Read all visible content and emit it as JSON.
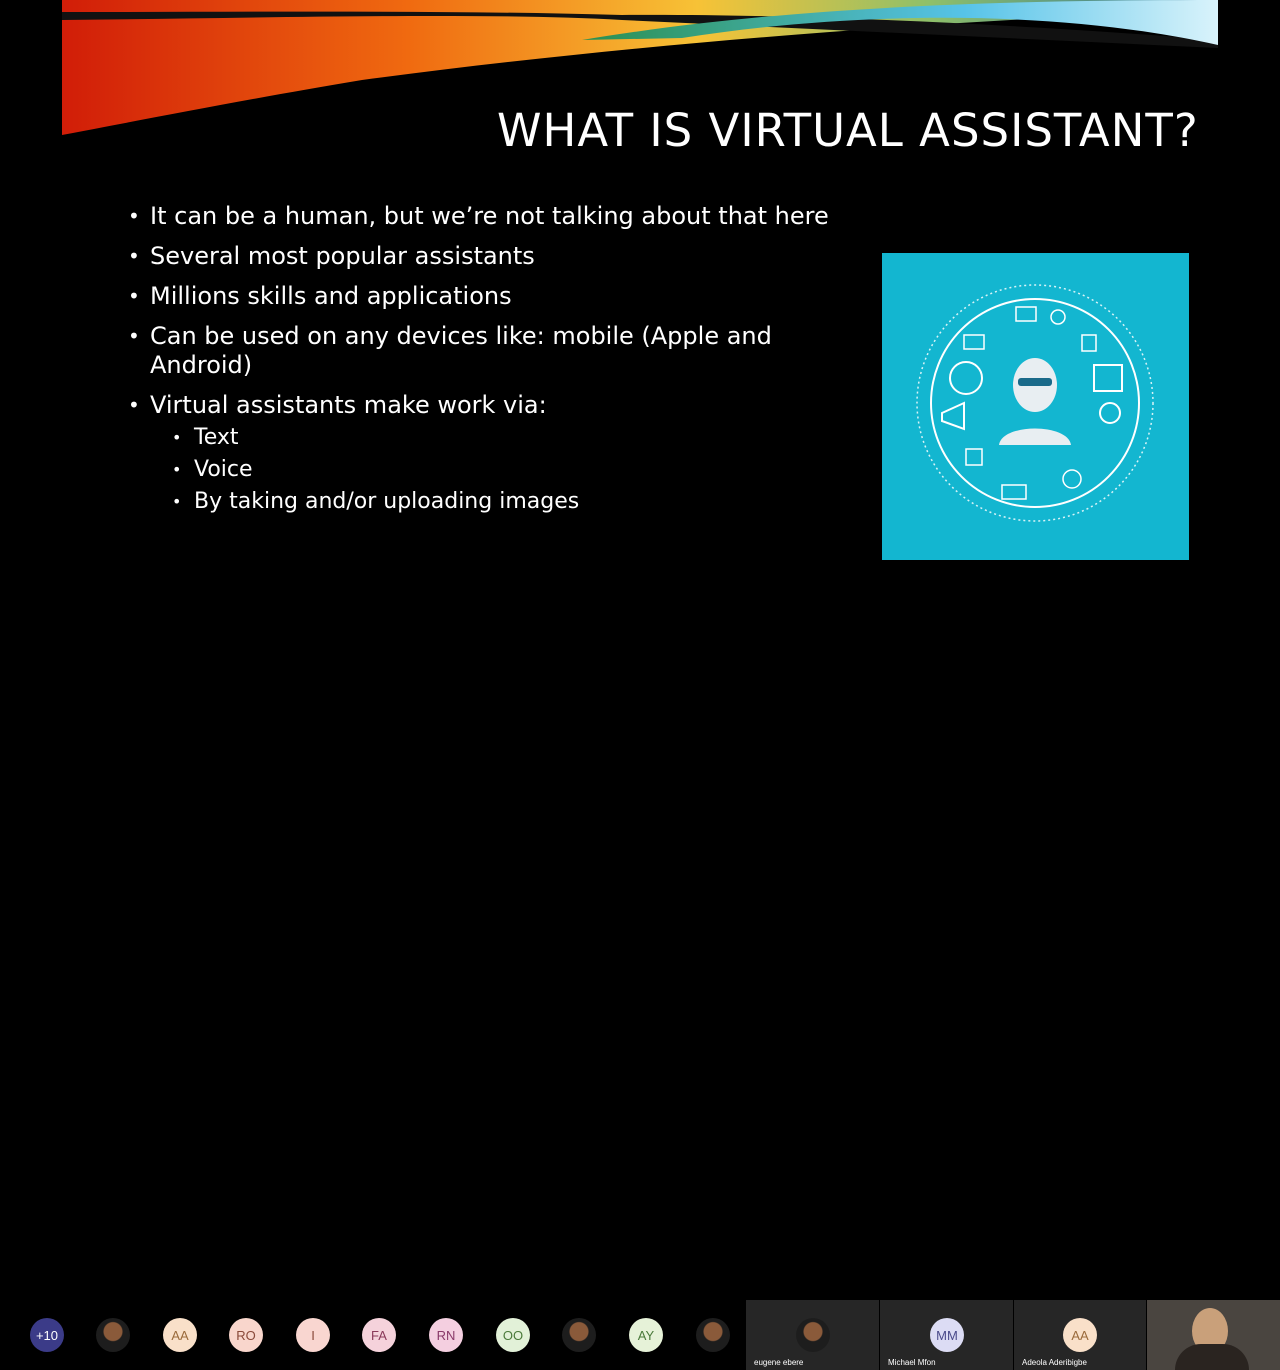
{
  "slide": {
    "title": "WHAT IS VIRTUAL ASSISTANT?",
    "bullets": [
      "It can be a human, but we’re not talking about that here",
      "Several most popular assistants",
      "Millions skills and applications",
      "Can be used on any devices like: mobile (Apple and Android)",
      "Virtual assistants make work via:"
    ],
    "sub_bullets": [
      "Text",
      "Voice",
      "By taking and/or uploading images"
    ],
    "image_bg_color": "#13b6d0"
  },
  "participants": {
    "more_count": "+10",
    "avatars": [
      {
        "label": "",
        "type": "photo"
      },
      {
        "label": "AA",
        "color": "#f9e0c9"
      },
      {
        "label": "RO",
        "color": "#f9d6cc"
      },
      {
        "label": "I",
        "color": "#f9d6d0"
      },
      {
        "label": "FA",
        "color": "#f5d2db"
      },
      {
        "label": "RN",
        "color": "#f4cfe0"
      },
      {
        "label": "OO",
        "color": "#e2f1d8"
      },
      {
        "label": "",
        "type": "photo"
      },
      {
        "label": "AY",
        "color": "#e6f2d8"
      },
      {
        "label": "",
        "type": "photo"
      }
    ],
    "tiles": [
      {
        "name": "eugene ebere",
        "type": "photo"
      },
      {
        "name": "Michael Mfon",
        "initials": "MM",
        "color": "#dcdcf4"
      },
      {
        "name": "Adeola Aderibigbe",
        "initials": "AA",
        "color": "#f9e0c9"
      }
    ]
  }
}
